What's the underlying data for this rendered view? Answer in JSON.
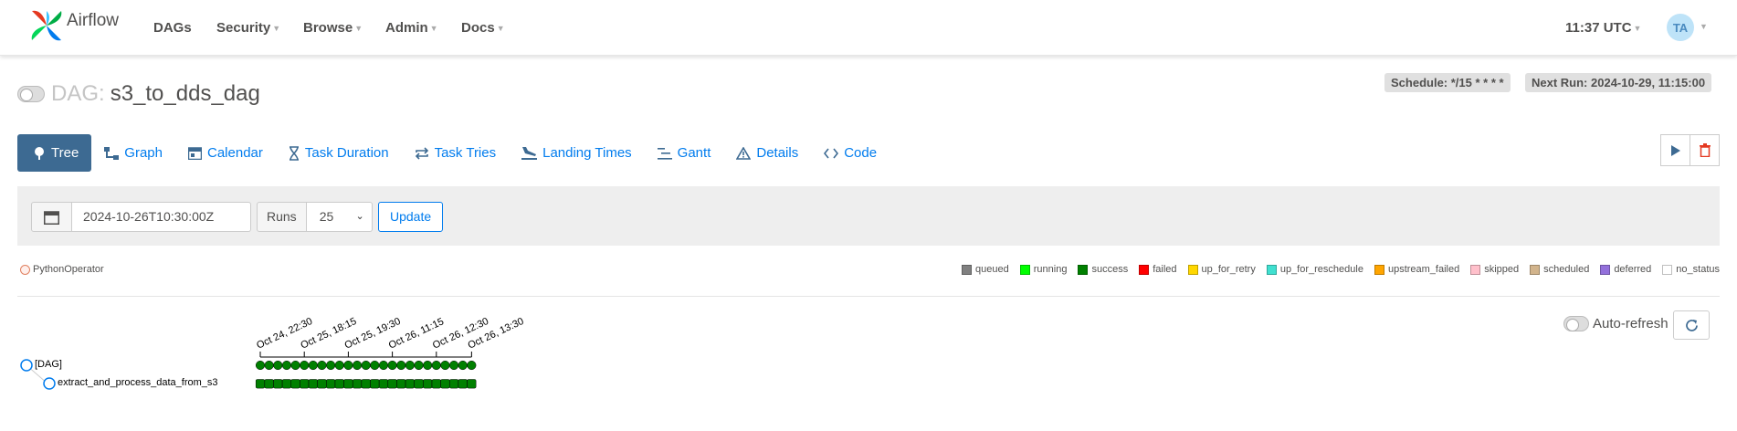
{
  "brand": {
    "name": "Airflow"
  },
  "nav": {
    "items": [
      {
        "label": "DAGs",
        "caret": false
      },
      {
        "label": "Security",
        "caret": true
      },
      {
        "label": "Browse",
        "caret": true
      },
      {
        "label": "Admin",
        "caret": true
      },
      {
        "label": "Docs",
        "caret": true
      }
    ],
    "clock": "11:37 UTC",
    "avatar": "TA"
  },
  "dag": {
    "label": "DAG:",
    "id": "s3_to_dds_dag",
    "schedule": "Schedule: */15 * * * *",
    "next_run": "Next Run: 2024-10-29, 11:15:00"
  },
  "tabs": [
    {
      "label": "Tree",
      "icon": "tree-icon",
      "active": true
    },
    {
      "label": "Graph",
      "icon": "graph-icon",
      "active": false
    },
    {
      "label": "Calendar",
      "icon": "calendar-icon",
      "active": false
    },
    {
      "label": "Task Duration",
      "icon": "hourglass-icon",
      "active": false
    },
    {
      "label": "Task Tries",
      "icon": "repeat-icon",
      "active": false
    },
    {
      "label": "Landing Times",
      "icon": "plane-landing-icon",
      "active": false
    },
    {
      "label": "Gantt",
      "icon": "gantt-icon",
      "active": false
    },
    {
      "label": "Details",
      "icon": "warning-triangle-icon",
      "active": false
    },
    {
      "label": "Code",
      "icon": "code-icon",
      "active": false
    }
  ],
  "filter": {
    "base_date": "2024-10-26T10:30:00Z",
    "runs_label": "Runs",
    "runs_value": "25",
    "update_label": "Update"
  },
  "operator": "PythonOperator",
  "legend": [
    {
      "label": "queued",
      "color": "#808080"
    },
    {
      "label": "running",
      "color": "#00ff00"
    },
    {
      "label": "success",
      "color": "#008000"
    },
    {
      "label": "failed",
      "color": "#ff0000"
    },
    {
      "label": "up_for_retry",
      "color": "#ffd700"
    },
    {
      "label": "up_for_reschedule",
      "color": "#40e0d0"
    },
    {
      "label": "upstream_failed",
      "color": "#ffa500"
    },
    {
      "label": "skipped",
      "color": "#ffc0cb"
    },
    {
      "label": "scheduled",
      "color": "#d2b48c"
    },
    {
      "label": "deferred",
      "color": "#9370db"
    },
    {
      "label": "no_status",
      "color": "#ffffff"
    }
  ],
  "autorefresh": "Auto-refresh",
  "tree": {
    "date_labels": [
      "Oct 24, 22:30",
      "Oct 25, 18:15",
      "Oct 25, 19:30",
      "Oct 26, 11:15",
      "Oct 26, 12:30",
      "Oct 26, 13:30"
    ],
    "dag_node": "[DAG]",
    "task_node": "extract_and_process_data_from_s3",
    "run_count": 25,
    "run_state": "success",
    "task_state": "success"
  }
}
